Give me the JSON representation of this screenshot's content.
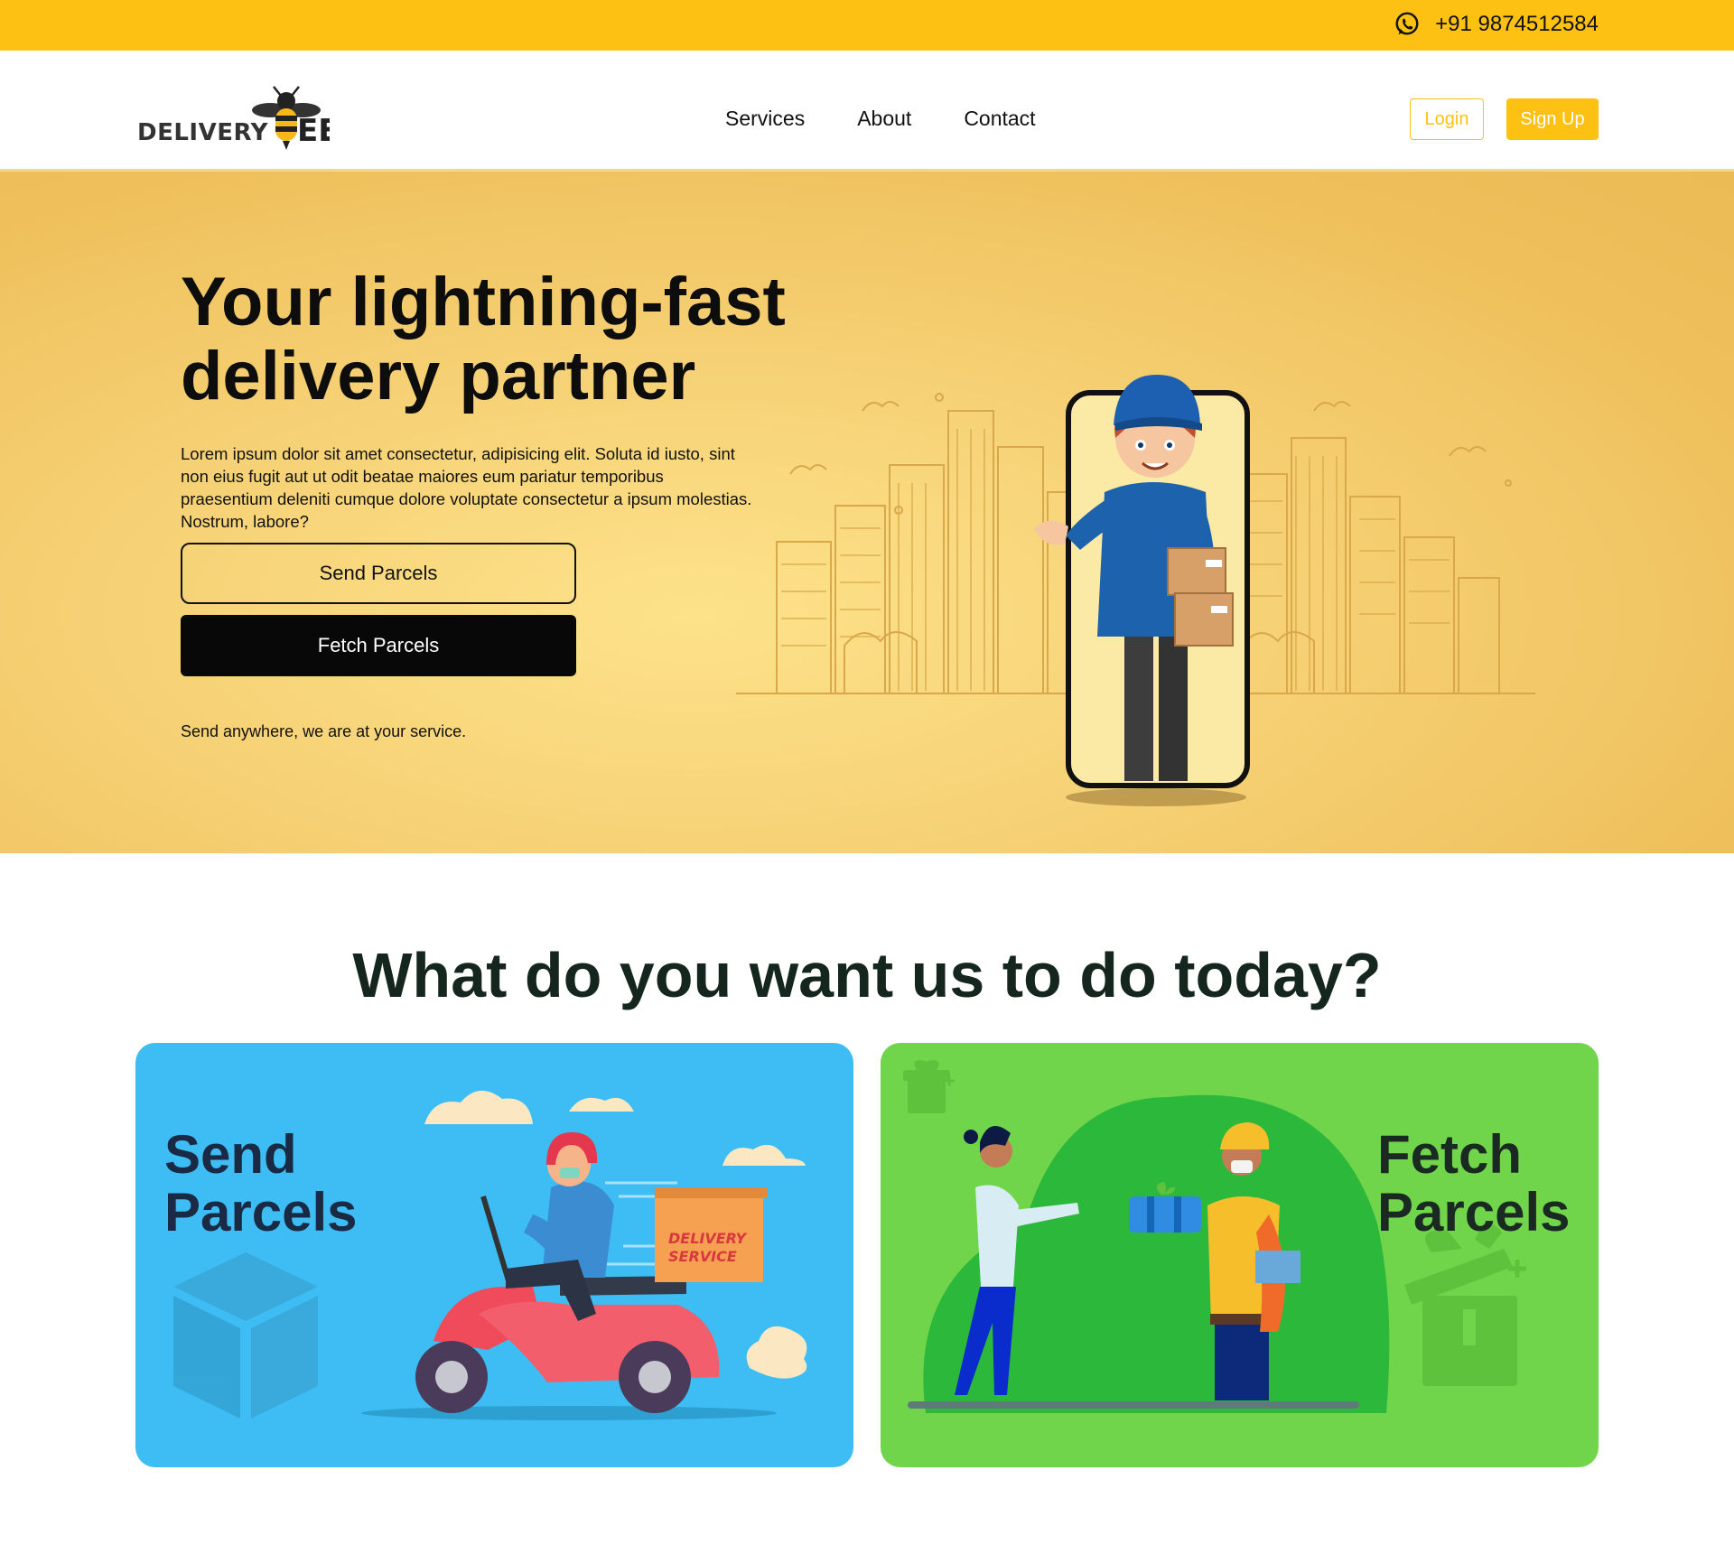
{
  "topbar": {
    "phone_number": "+91 9874512584",
    "phone_icon": "whatsapp-icon",
    "background_color": "#fdc113"
  },
  "navbar": {
    "logo_text": "DELIVERY",
    "logo_suffix": "BEE",
    "links": [
      {
        "label": "Services"
      },
      {
        "label": "About"
      },
      {
        "label": "Contact"
      }
    ],
    "login_label": "Login",
    "signup_label": "Sign Up",
    "accent_color": "#fdc113"
  },
  "hero": {
    "title": "Your lightning-fast delivery partner",
    "description": "Lorem ipsum dolor sit amet consectetur, adipisicing elit. Soluta id iusto, sint non eius fugit aut ut odit beatae maiores eum pariatur temporibus praesentium deleniti cumque dolore voluptate consectetur a ipsum molestias. Nostrum, labore?",
    "send_button_label": "Send Parcels",
    "fetch_button_label": "Fetch Parcels",
    "tagline": "Send anywhere, we are at your service."
  },
  "services": {
    "heading": "What do you want us to do today?",
    "cards": [
      {
        "title_line1": "Send",
        "title_line2": "Parcels",
        "color": "#3dbdf3",
        "box_label_line1": "DELIVERY",
        "box_label_line2": "SERVICE"
      },
      {
        "title_line1": "Fetch",
        "title_line2": "Parcels",
        "color": "#71d54b"
      }
    ]
  }
}
